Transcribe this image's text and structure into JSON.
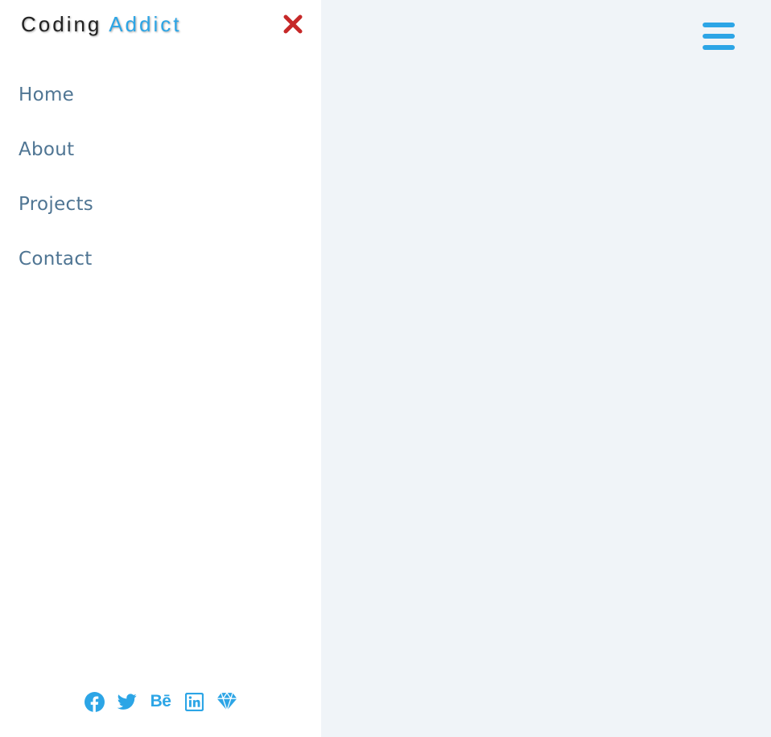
{
  "logo": {
    "part1": "Coding",
    "part2": "Addict"
  },
  "nav": {
    "links": [
      {
        "label": "Home"
      },
      {
        "label": "About"
      },
      {
        "label": "Projects"
      },
      {
        "label": "Contact"
      }
    ]
  },
  "icons": {
    "close": "close-icon",
    "toggle": "hamburger-menu-icon",
    "social": [
      "facebook-icon",
      "twitter-icon",
      "behance-icon",
      "linkedin-icon",
      "sketch-icon"
    ]
  },
  "social": {
    "behance_text": "Bē"
  },
  "colors": {
    "accent": "#2ca5e6",
    "close": "#c62828",
    "nav_text": "#4f7593",
    "main_bg": "#f0f4f8",
    "sidebar_bg": "#ffffff"
  }
}
